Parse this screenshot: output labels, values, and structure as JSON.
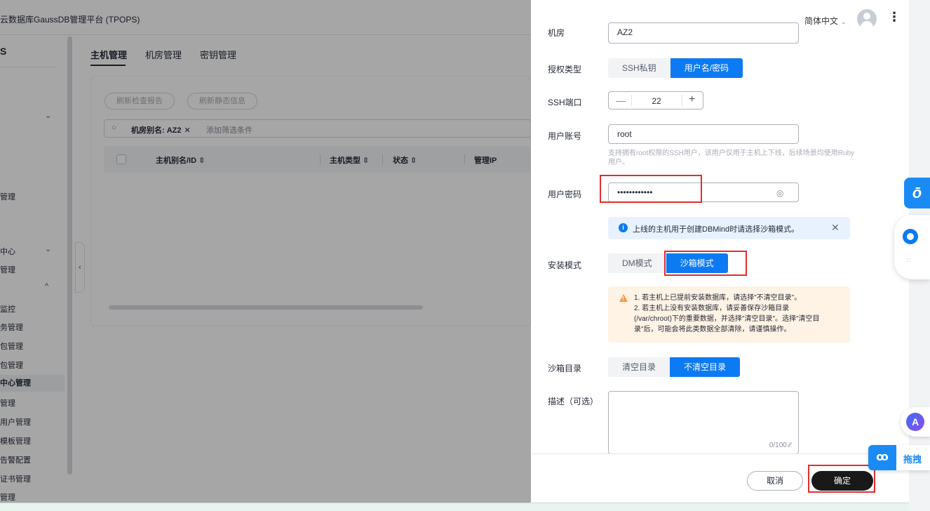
{
  "topbar": {
    "title": "云数据库GaussDB管理平台 (TPOPS)",
    "lang": "简体中文",
    "lang_chevron": "⌄",
    "more": "⋮"
  },
  "sidebar": {
    "brand": "S",
    "items": [
      {
        "label": "管理"
      },
      {
        "label": "中心"
      },
      {
        "label": "管理"
      },
      {
        "label": "监控"
      },
      {
        "label": "务管理"
      },
      {
        "label": "包管理"
      },
      {
        "label": "包管理"
      },
      {
        "label": "中心管理"
      },
      {
        "label": "管理"
      },
      {
        "label": "用户管理"
      },
      {
        "label": "模板管理"
      },
      {
        "label": "告警配置"
      },
      {
        "label": "证书管理"
      },
      {
        "label": "管理"
      }
    ],
    "chevrons": [
      "⌄",
      "⌄",
      "^"
    ]
  },
  "main": {
    "tabs": [
      {
        "label": "主机管理"
      },
      {
        "label": "机房管理"
      },
      {
        "label": "密钥管理"
      }
    ],
    "buttons": {
      "check_report": "刷新检查报告",
      "static_info": "刷新静态信息"
    },
    "filter": {
      "search_icon": "○",
      "tag": "机房别名: AZ2",
      "tag_close": "✕",
      "placeholder": "添加筛选条件"
    },
    "columns": [
      "主机别名/ID ⇳",
      "主机类型 ⇳",
      "状态 ⇳",
      "管理IP"
    ],
    "collapse_icon": "‹"
  },
  "drawer": {
    "fields": {
      "room": {
        "label": "机房",
        "value": "AZ2"
      },
      "auth_type": {
        "label": "授权类型",
        "options": [
          "SSH私钥",
          "用户名/密码"
        ],
        "selected": "用户名/密码"
      },
      "ssh_port": {
        "label": "SSH端口",
        "value": "22",
        "minus": "—",
        "plus": "+"
      },
      "user_account": {
        "label": "用户账号",
        "value": "root",
        "hint": "支持拥有root权限的SSH用户，该用户仅用于主机上下线，后续场景均使用Ruby用户。"
      },
      "user_password": {
        "label": "用户密码",
        "value": "••••••••••••",
        "eye_icon": "◎"
      },
      "info": {
        "icon": "i",
        "text": "上线的主机用于创建DBMind时请选择沙箱模式。",
        "close": "✕"
      },
      "install_mode": {
        "label": "安装模式",
        "options": [
          "DM模式",
          "沙箱模式"
        ],
        "selected": "沙箱模式"
      },
      "warning": {
        "icon": "!",
        "lines": [
          "1. 若主机上已提前安装数据库，请选择\"不清空目录\"。",
          "2. 若主机上没有安装数据库，请妥善保存沙箱目录",
          "(/var/chroot)下的重要数据，并选择\"清空目录\"。选择\"清空目",
          "录\"后，可能会将此类数据全部清除，请谨慎操作。"
        ]
      },
      "sandbox_dir": {
        "label": "沙箱目录",
        "options": [
          "清空目录",
          "不清空目录"
        ],
        "selected": "不清空目录"
      },
      "description": {
        "label": "描述（可选）",
        "count": "0/100 ⁄⁄"
      }
    },
    "buttons": {
      "cancel": "取消",
      "confirm": "确定"
    }
  },
  "rail": {
    "float1_icon": "ō",
    "float3_icon": "A",
    "float4_icon": "ꝏ",
    "float4_label": "拖拽"
  }
}
